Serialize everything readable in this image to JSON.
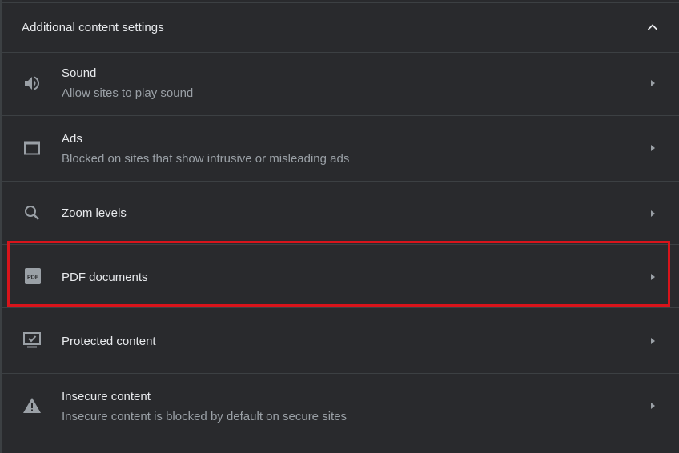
{
  "section": {
    "title": "Additional content settings",
    "collapse_icon": "chevron-up-icon"
  },
  "rows": [
    {
      "key": "sound",
      "title": "Sound",
      "subtitle": "Allow sites to play sound",
      "icon": "speaker-icon"
    },
    {
      "key": "ads",
      "title": "Ads",
      "subtitle": "Blocked on sites that show intrusive or misleading ads",
      "icon": "window-icon"
    },
    {
      "key": "zoom",
      "title": "Zoom levels",
      "subtitle": "",
      "icon": "search-icon"
    },
    {
      "key": "pdf",
      "title": "PDF documents",
      "subtitle": "",
      "icon": "pdf-icon",
      "pdf_icon_text": "PDF",
      "highlighted": true
    },
    {
      "key": "protected",
      "title": "Protected content",
      "subtitle": "",
      "icon": "monitor-check-icon"
    },
    {
      "key": "insecure",
      "title": "Insecure content",
      "subtitle": "Insecure content is blocked by default on secure sites",
      "icon": "warning-icon"
    }
  ],
  "colors": {
    "background": "#292a2d",
    "divider": "#3c4043",
    "primary_text": "#e8eaed",
    "secondary_text": "#9aa0a6",
    "icon": "#9aa0a6",
    "highlight_border": "#d8141b"
  }
}
